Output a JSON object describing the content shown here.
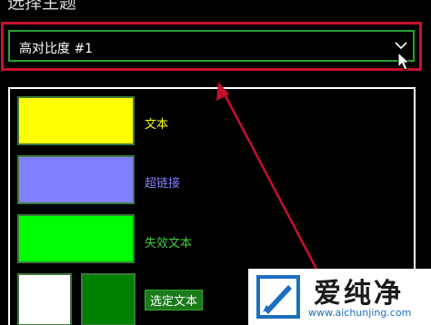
{
  "section_title": "选择主题",
  "theme_select": {
    "selected_value": "高对比度 #1"
  },
  "preview": {
    "text_label": "文本",
    "hyperlink_label": "超链接",
    "disabled_text_label": "失效文本",
    "selected_text_label": "选定文本"
  },
  "colors": {
    "text_swatch": "#ffff00",
    "hyperlink_swatch": "#8080ff",
    "disabled_text_swatch": "#00ff00",
    "selected_bg_swatch": "#ffffff",
    "selected_fg_swatch": "#008000",
    "annotation_red": "#c8102e"
  },
  "icons": {
    "dropdown": "chevron-down-icon",
    "cursor": "mouse-pointer-icon",
    "annotation": "red-arrow-icon"
  },
  "watermark": {
    "name": "爱纯净",
    "url": "www.aichunjing.com"
  }
}
